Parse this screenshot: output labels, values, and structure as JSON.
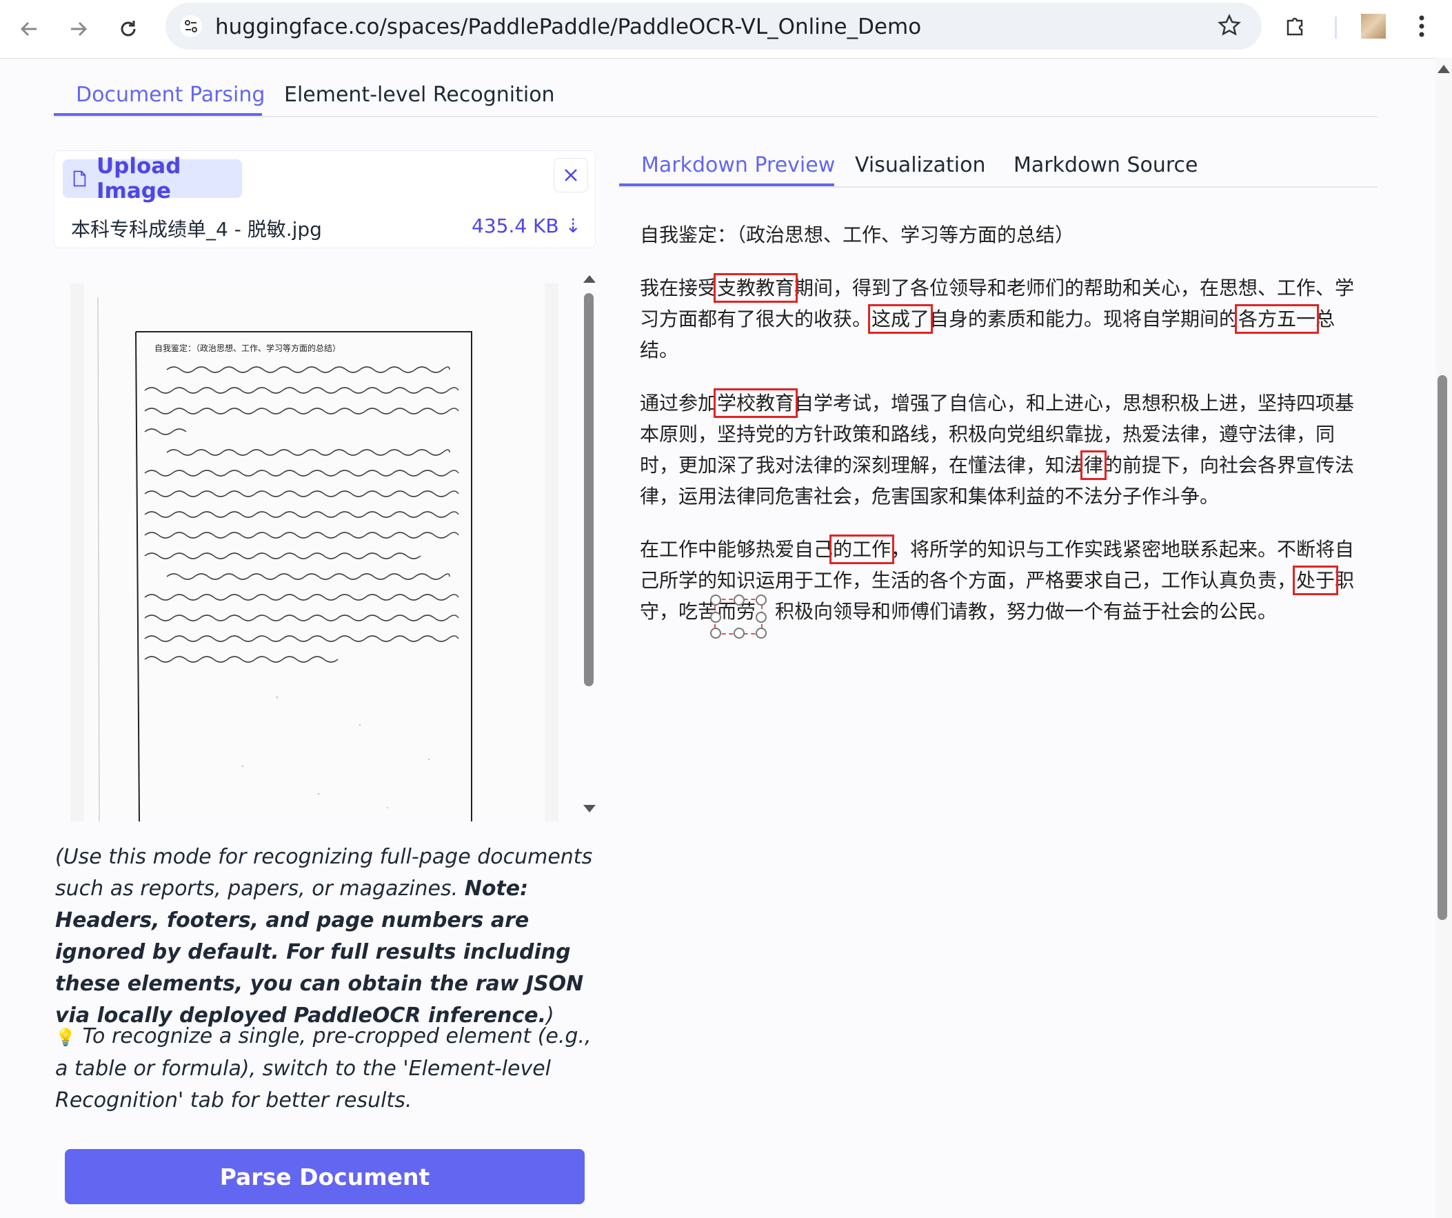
{
  "browser": {
    "url": "huggingface.co/spaces/PaddlePaddle/PaddleOCR-VL_Online_Demo",
    "icons": [
      "back-arrow-icon",
      "forward-arrow-icon",
      "reload-icon",
      "site-settings-icon",
      "bookmark-star-icon",
      "extensions-icon",
      "profile-avatar",
      "menu-kebab-icon"
    ]
  },
  "top_tabs": [
    {
      "label": "Document Parsing",
      "active": true
    },
    {
      "label": "Element-level Recognition",
      "active": false
    }
  ],
  "upload": {
    "label": "Upload Image",
    "file_name": "本科专科成绩单_4 - 脱敏.jpg",
    "file_size": "435.4 KB ⇣"
  },
  "document_image": {
    "header": "自我鉴定：（政治思想、工作、学习等方面的总结）"
  },
  "note": {
    "intro": "(Use this mode for recognizing full-page documents such as reports, papers, or magazines.",
    "bold": "Note: Headers, footers, and page numbers are ignored by default. For full results including these elements, you can obtain the raw JSON via locally deployed PaddleOCR inference.",
    "close": ")"
  },
  "tip": {
    "icon": "💡",
    "text": "To recognize a single, pre-cropped element (e.g., a table or formula), switch to the 'Element-level Recognition' tab for better results."
  },
  "parse_button": "Parse Document",
  "result_tabs": [
    {
      "label": "Markdown Preview",
      "active": true
    },
    {
      "label": "Visualization",
      "active": false
    },
    {
      "label": "Markdown Source",
      "active": false
    }
  ],
  "markdown": {
    "p1": "自我鉴定：（政治思想、工作、学习等方面的总结）",
    "p2": [
      "我在接受",
      "支教教育",
      "期间，得到了各位领导和老师们的帮助和关心，在思想、工作、学习方面都有了很大的收获。",
      "这成了",
      "自身的素质和能力。现将自学期间的",
      "各方五一",
      "总结。"
    ],
    "p3": [
      "通过参加",
      "学校教育",
      "自学考试，增强了自信心，和上进心，思想积极上进，坚持四项基本原则，坚持党的方针政策和路线，积极向党组织靠拢，热爱法律，遵守法律，同时，更加深了我对法律的深刻理解，在懂法律，知法",
      "律",
      "的前提下，向社会各界宣传法律，运用法律同危害社会，危害国家和集体利益的不法分子作斗争。"
    ],
    "p4": [
      "在工作中能够热爱自己",
      "的工作",
      "，将所学的知识与工作实践紧密地联系起来。不断将自己所学的知识运用于工作，生活的各个方面，严格要求自己，工作认真负责，",
      "处于",
      "职守，吃苦而劳，积极向领导和师傅们请教，努力做一个有益于社会的公民。"
    ]
  },
  "colors": {
    "accent": "#6366f1",
    "highlight": "#e02424",
    "upload_bg": "#e0e7ff"
  }
}
